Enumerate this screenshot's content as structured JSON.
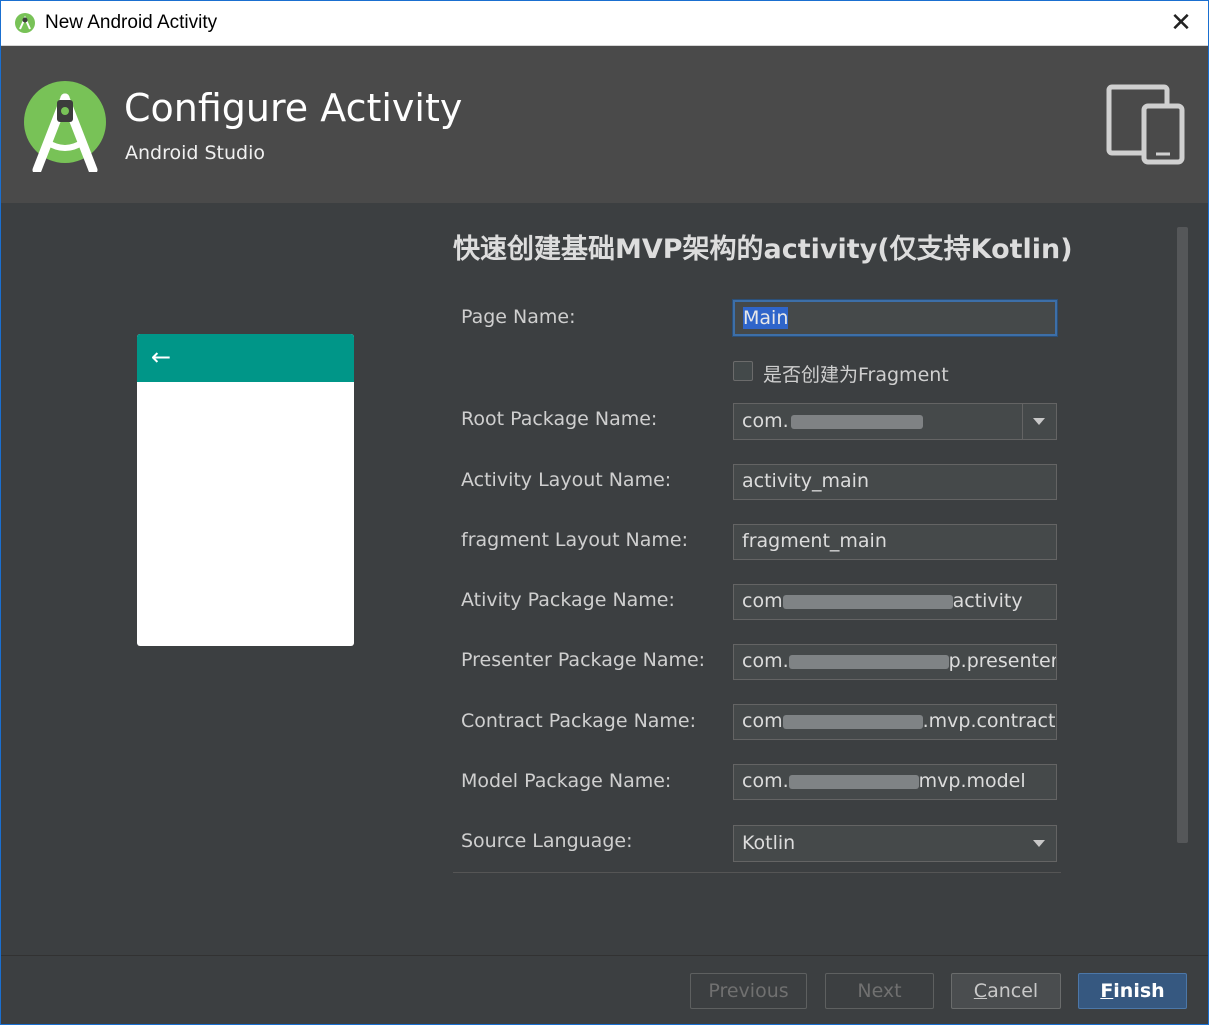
{
  "window": {
    "title": "New Android Activity",
    "close_glyph": "✕"
  },
  "header": {
    "title": "Configure Activity",
    "subtitle": "Android Studio"
  },
  "form": {
    "section_title": "快速创建基础MVP架构的activity(仅支持Kotlin)",
    "page_name": {
      "label": "Page Name:",
      "value": "Main"
    },
    "fragment_checkbox": {
      "label": "是否创建为Fragment",
      "checked": false
    },
    "root_package": {
      "label": "Root Package Name:",
      "value": "com."
    },
    "activity_layout": {
      "label": "Activity Layout Name:",
      "value": "activity_main"
    },
    "fragment_layout": {
      "label": "fragment Layout Name:",
      "value": "fragment_main"
    },
    "activity_package": {
      "label": "Ativity Package Name:",
      "prefix": "com",
      "suffix": "activity"
    },
    "presenter_package": {
      "label": "Presenter Package Name:",
      "prefix": "com.",
      "suffix": "p.presenter"
    },
    "contract_package": {
      "label": "Contract Package Name:",
      "prefix": "com",
      "suffix": ".mvp.contract"
    },
    "model_package": {
      "label": "Model Package Name:",
      "prefix": "com.",
      "suffix": "mvp.model"
    },
    "source_language": {
      "label": "Source Language:",
      "value": "Kotlin"
    }
  },
  "preview": {
    "back_glyph": "←",
    "appbar_color": "#009688"
  },
  "buttons": {
    "previous": "Previous",
    "next": "Next",
    "cancel_mnemonic": "C",
    "cancel_rest": "ancel",
    "finish_mnemonic": "F",
    "finish_rest": "inish"
  }
}
